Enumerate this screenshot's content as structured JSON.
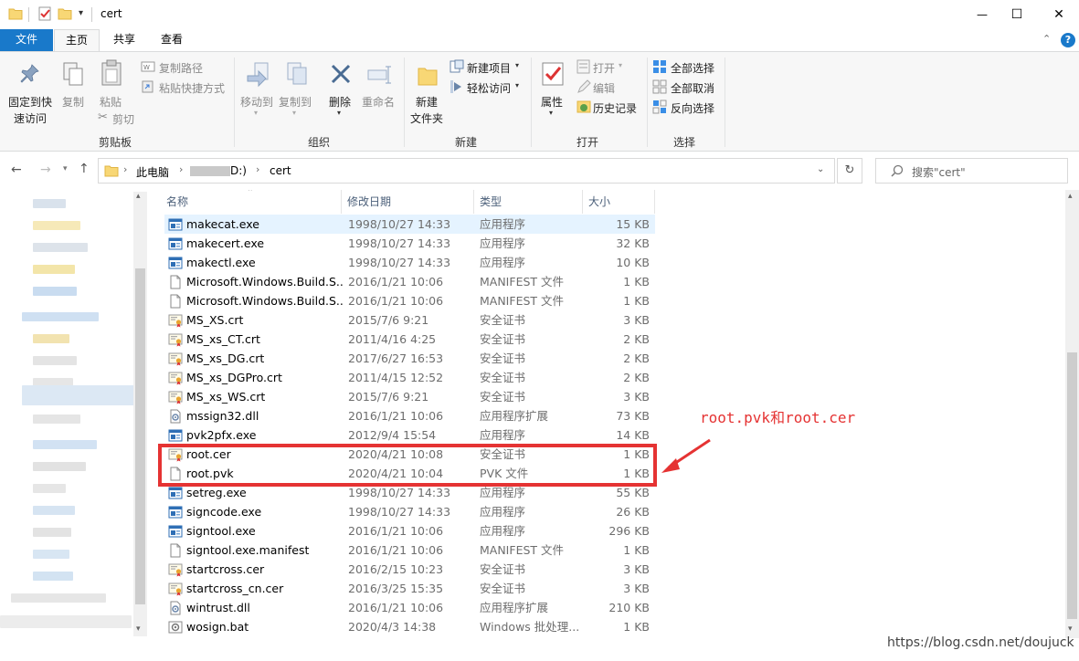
{
  "window": {
    "title": "cert",
    "min_glyph": "—",
    "max_glyph": "☐",
    "close_glyph": "✕"
  },
  "ribbon_tabs": [
    {
      "label": "文件"
    },
    {
      "label": "主页"
    },
    {
      "label": "共享"
    },
    {
      "label": "查看"
    }
  ],
  "ribbon": {
    "clipboard": {
      "pin": "固定到快速访问",
      "pin_line1": "固定到快",
      "pin_line2": "速访问",
      "copy": "复制",
      "paste": "粘贴",
      "copy_path": "复制路径",
      "paste_shortcut": "粘贴快捷方式",
      "cut": "剪切",
      "group": "剪贴板"
    },
    "organize": {
      "move_to": "移动到",
      "copy_to": "复制到",
      "delete": "删除",
      "rename": "重命名",
      "group": "组织"
    },
    "new": {
      "new_folder_line1": "新建",
      "new_folder_line2": "文件夹",
      "new_item": "新建项目",
      "easy_access": "轻松访问",
      "group": "新建"
    },
    "open": {
      "properties": "属性",
      "open": "打开",
      "edit": "编辑",
      "history": "历史记录",
      "group": "打开"
    },
    "select": {
      "select_all": "全部选择",
      "select_none": "全部取消",
      "invert": "反向选择",
      "group": "选择"
    }
  },
  "address": {
    "crumbs": [
      "此电脑",
      "D:)",
      "cert"
    ],
    "search_placeholder": "搜索\"cert\""
  },
  "columns": {
    "name": "名称",
    "date": "修改日期",
    "type": "类型",
    "size": "大小"
  },
  "files": [
    {
      "name": "makecat.exe",
      "date": "1998/10/27 14:33",
      "type": "应用程序",
      "size": "15 KB",
      "icon": "exe-icon"
    },
    {
      "name": "makecert.exe",
      "date": "1998/10/27 14:33",
      "type": "应用程序",
      "size": "32 KB",
      "icon": "exe-icon"
    },
    {
      "name": "makectl.exe",
      "date": "1998/10/27 14:33",
      "type": "应用程序",
      "size": "10 KB",
      "icon": "exe-icon"
    },
    {
      "name": "Microsoft.Windows.Build.S...",
      "date": "2016/1/21 10:06",
      "type": "MANIFEST 文件",
      "size": "1 KB",
      "icon": "file-icon"
    },
    {
      "name": "Microsoft.Windows.Build.S...",
      "date": "2016/1/21 10:06",
      "type": "MANIFEST 文件",
      "size": "1 KB",
      "icon": "file-icon"
    },
    {
      "name": "MS_XS.crt",
      "date": "2015/7/6 9:21",
      "type": "安全证书",
      "size": "3 KB",
      "icon": "cert-icon"
    },
    {
      "name": "MS_xs_CT.crt",
      "date": "2011/4/16 4:25",
      "type": "安全证书",
      "size": "2 KB",
      "icon": "cert-icon"
    },
    {
      "name": "MS_xs_DG.crt",
      "date": "2017/6/27 16:53",
      "type": "安全证书",
      "size": "2 KB",
      "icon": "cert-icon"
    },
    {
      "name": "MS_xs_DGPro.crt",
      "date": "2011/4/15 12:52",
      "type": "安全证书",
      "size": "2 KB",
      "icon": "cert-icon"
    },
    {
      "name": "MS_xs_WS.crt",
      "date": "2015/7/6 9:21",
      "type": "安全证书",
      "size": "3 KB",
      "icon": "cert-icon"
    },
    {
      "name": "mssign32.dll",
      "date": "2016/1/21 10:06",
      "type": "应用程序扩展",
      "size": "73 KB",
      "icon": "dll-icon"
    },
    {
      "name": "pvk2pfx.exe",
      "date": "2012/9/4 15:54",
      "type": "应用程序",
      "size": "14 KB",
      "icon": "exe-icon"
    },
    {
      "name": "root.cer",
      "date": "2020/4/21 10:08",
      "type": "安全证书",
      "size": "1 KB",
      "icon": "cert-icon"
    },
    {
      "name": "root.pvk",
      "date": "2020/4/21 10:04",
      "type": "PVK 文件",
      "size": "1 KB",
      "icon": "file-icon"
    },
    {
      "name": "setreg.exe",
      "date": "1998/10/27 14:33",
      "type": "应用程序",
      "size": "55 KB",
      "icon": "exe-icon"
    },
    {
      "name": "signcode.exe",
      "date": "1998/10/27 14:33",
      "type": "应用程序",
      "size": "26 KB",
      "icon": "exe-icon"
    },
    {
      "name": "signtool.exe",
      "date": "2016/1/21 10:06",
      "type": "应用程序",
      "size": "296 KB",
      "icon": "exe-icon"
    },
    {
      "name": "signtool.exe.manifest",
      "date": "2016/1/21 10:06",
      "type": "MANIFEST 文件",
      "size": "1 KB",
      "icon": "file-icon"
    },
    {
      "name": "startcross.cer",
      "date": "2016/2/15 10:23",
      "type": "安全证书",
      "size": "3 KB",
      "icon": "cert-icon"
    },
    {
      "name": "startcross_cn.cer",
      "date": "2016/3/25 15:35",
      "type": "安全证书",
      "size": "3 KB",
      "icon": "cert-icon"
    },
    {
      "name": "wintrust.dll",
      "date": "2016/1/21 10:06",
      "type": "应用程序扩展",
      "size": "210 KB",
      "icon": "dll-icon"
    },
    {
      "name": "wosign.bat",
      "date": "2020/4/3 14:38",
      "type": "Windows 批处理...",
      "size": "1 KB",
      "icon": "bat-icon"
    }
  ],
  "annotation": {
    "text": "root.pvk和root.cer",
    "color": "#e53333"
  },
  "watermark": "https://blog.csdn.net/doujuck",
  "colors": {
    "accent": "#1979ca",
    "selected_row": "#e5f3ff",
    "highlight_box": "#e53333"
  }
}
